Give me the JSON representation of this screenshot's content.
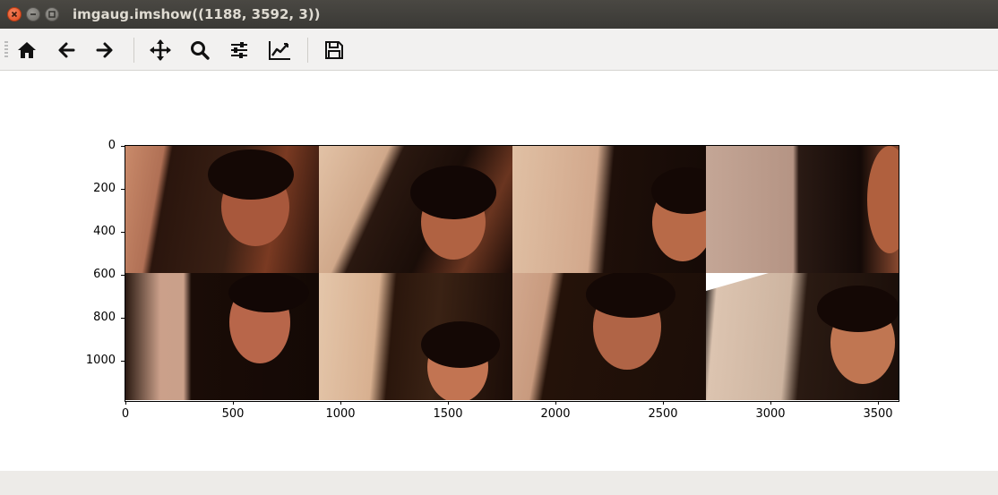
{
  "window": {
    "title": "imgaug.imshow((1188, 3592, 3))",
    "buttons": [
      {
        "name": "close-button",
        "icon": "close-icon"
      },
      {
        "name": "minimize-button",
        "icon": "minimize-icon"
      },
      {
        "name": "maximize-button",
        "icon": "maximize-icon"
      }
    ]
  },
  "toolbar": {
    "tools": [
      {
        "name": "home-button",
        "icon": "home-icon"
      },
      {
        "name": "back-button",
        "icon": "arrow-left-icon"
      },
      {
        "name": "forward-button",
        "icon": "arrow-right-icon"
      },
      {
        "name": "pan-button",
        "icon": "move-icon"
      },
      {
        "name": "zoom-button",
        "icon": "zoom-icon"
      },
      {
        "name": "configure-subplots-button",
        "icon": "sliders-icon"
      },
      {
        "name": "edit-axes-button",
        "icon": "line-chart-icon"
      },
      {
        "name": "save-button",
        "icon": "save-icon"
      }
    ]
  },
  "plot": {
    "image_shape": [
      1188,
      3592,
      3
    ],
    "grid": {
      "rows": 2,
      "cols": 4
    },
    "y_ticks": [
      "0",
      "200",
      "400",
      "600",
      "800",
      "1000"
    ],
    "x_ticks": [
      "0",
      "500",
      "1000",
      "1500",
      "2000",
      "2500",
      "3000",
      "3500"
    ],
    "tiles_description": "photo-grid",
    "colors": {
      "dark": "#120805",
      "skin": "#c07050",
      "light": "#d8b89c"
    }
  }
}
